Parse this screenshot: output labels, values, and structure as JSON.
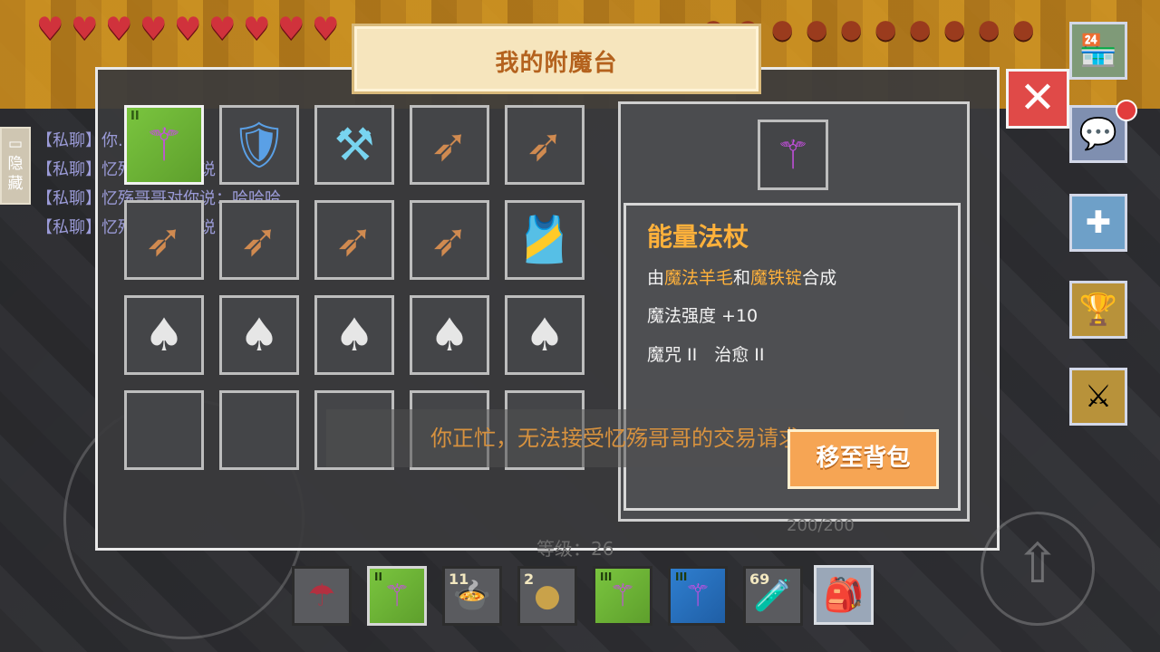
{
  "title": "我的附魔台",
  "chat": {
    "hide_label": "隐藏",
    "rows": [
      "【私聊】你...",
      "【私聊】忆殇哥哥对你说",
      "【私聊】忆殇哥哥对你说：哈哈哈",
      "【私聊】忆殇哥哥对你说"
    ]
  },
  "grid_slots": [
    {
      "icon": "magic-staff-icon",
      "glyph": "⚚",
      "selected": true,
      "enchant_level": "II"
    },
    {
      "icon": "shield-badge-icon",
      "glyph": "🛡"
    },
    {
      "icon": "diamond-hammer-icon",
      "glyph": "⚒"
    },
    {
      "icon": "arrow-quiver-icon",
      "glyph": "➶"
    },
    {
      "icon": "arrow-quiver-icon",
      "glyph": "➶"
    },
    {
      "icon": "arrow-quiver-icon",
      "glyph": "➶"
    },
    {
      "icon": "arrow-quiver-icon",
      "glyph": "➶"
    },
    {
      "icon": "arrow-quiver-icon",
      "glyph": "➶"
    },
    {
      "icon": "arrow-quiver-icon",
      "glyph": "➶"
    },
    {
      "icon": "red-armor-icon",
      "glyph": "🎽"
    },
    {
      "icon": "shovel-icon",
      "glyph": "♠"
    },
    {
      "icon": "shovel-icon",
      "glyph": "♠"
    },
    {
      "icon": "shovel-icon",
      "glyph": "♠"
    },
    {
      "icon": "shovel-icon",
      "glyph": "♠"
    },
    {
      "icon": "shovel-icon",
      "glyph": "♠"
    },
    {
      "icon": "empty-slot",
      "glyph": ""
    },
    {
      "icon": "empty-slot",
      "glyph": ""
    },
    {
      "icon": "empty-slot",
      "glyph": ""
    },
    {
      "icon": "empty-slot",
      "glyph": ""
    },
    {
      "icon": "empty-slot",
      "glyph": ""
    }
  ],
  "detail": {
    "item_name": "能量法杖",
    "recipe_prefix": "由",
    "recipe_a": "魔法羊毛",
    "recipe_and": "和",
    "recipe_b": "魔铁锭",
    "recipe_suffix": "合成",
    "stat": "魔法强度 +10",
    "enchants": "魔咒 II　治愈 II",
    "move_button": "移至背包"
  },
  "toast": "你正忙，无法接受忆殇哥哥的交易请求",
  "level_text": "等级：26",
  "hp_text": "200/200",
  "hotbar": [
    {
      "icon": "umbrella-icon",
      "glyph": "☂",
      "count": "",
      "tag": "",
      "style": ""
    },
    {
      "icon": "magic-staff-icon",
      "glyph": "⚚",
      "count": "",
      "tag": "II",
      "style": "green"
    },
    {
      "icon": "stew-bowl-icon",
      "glyph": "🍲",
      "count": "11",
      "tag": "",
      "style": ""
    },
    {
      "icon": "gold-ore-icon",
      "glyph": "●",
      "count": "2",
      "tag": "",
      "style": ""
    },
    {
      "icon": "magic-staff-icon",
      "glyph": "⚚",
      "count": "",
      "tag": "III",
      "style": "green"
    },
    {
      "icon": "magic-staff-icon",
      "glyph": "⚚",
      "count": "",
      "tag": "III",
      "style": "blue"
    },
    {
      "icon": "red-potion-icon",
      "glyph": "🧪",
      "count": "69",
      "tag": "",
      "style": ""
    }
  ]
}
